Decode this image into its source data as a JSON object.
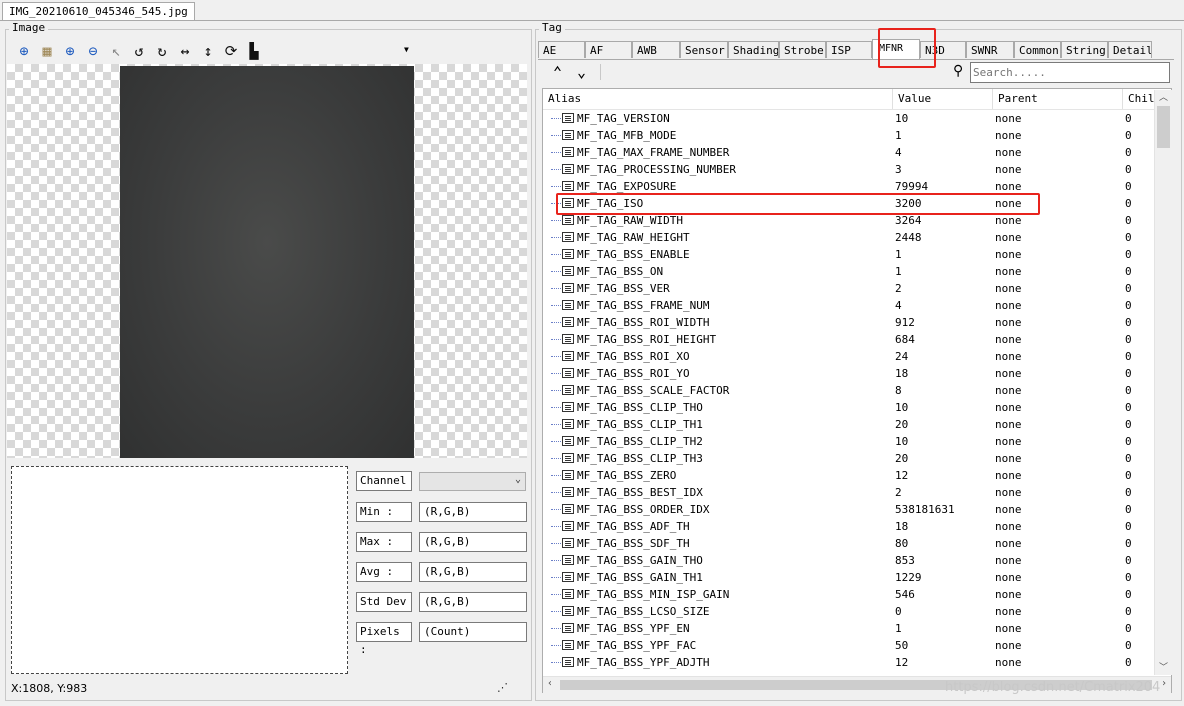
{
  "file_tab": "IMG_20210610_045346_545.jpg",
  "image_panel": {
    "title": "Image",
    "toolbar_icons": [
      "fit-icon",
      "grid-icon",
      "zoom-in-icon",
      "zoom-out-icon",
      "pointer-icon",
      "rotate-left-icon",
      "rotate-right-icon",
      "flip-horizontal-icon",
      "flip-vertical-icon",
      "refresh-icon",
      "histogram-icon",
      "dropdown-icon"
    ],
    "stats": [
      {
        "label": "Min :",
        "value": "(R,G,B)"
      },
      {
        "label": "Max :",
        "value": "(R,G,B)"
      },
      {
        "label": "Avg :",
        "value": "(R,G,B)"
      },
      {
        "label": "Std Dev",
        "value": "(R,G,B)"
      },
      {
        "label": "Pixels :",
        "value": "(Count)"
      }
    ],
    "channel_label": "Channel",
    "channel_value": "",
    "coords": "X:1808, Y:983"
  },
  "tag_panel": {
    "title": "Tag",
    "tabs": [
      "AE",
      "AF",
      "AWB",
      "Sensor",
      "Shading",
      "Strobe",
      "ISP",
      "MFNR",
      "N3D",
      "SWNR",
      "Common",
      "String",
      "Detail"
    ],
    "active_tab": "MFNR",
    "search_placeholder": "Search.....",
    "columns": [
      "Alias",
      "Value",
      "Parent",
      "Chil"
    ],
    "rows": [
      {
        "alias": "MF_TAG_VERSION",
        "value": "10",
        "parent": "none",
        "child": "0"
      },
      {
        "alias": "MF_TAG_MFB_MODE",
        "value": "1",
        "parent": "none",
        "child": "0"
      },
      {
        "alias": "MF_TAG_MAX_FRAME_NUMBER",
        "value": "4",
        "parent": "none",
        "child": "0"
      },
      {
        "alias": "MF_TAG_PROCESSING_NUMBER",
        "value": "3",
        "parent": "none",
        "child": "0"
      },
      {
        "alias": "MF_TAG_EXPOSURE",
        "value": "79994",
        "parent": "none",
        "child": "0"
      },
      {
        "alias": "MF_TAG_ISO",
        "value": "3200",
        "parent": "none",
        "child": "0"
      },
      {
        "alias": "MF_TAG_RAW_WIDTH",
        "value": "3264",
        "parent": "none",
        "child": "0"
      },
      {
        "alias": "MF_TAG_RAW_HEIGHT",
        "value": "2448",
        "parent": "none",
        "child": "0"
      },
      {
        "alias": "MF_TAG_BSS_ENABLE",
        "value": "1",
        "parent": "none",
        "child": "0"
      },
      {
        "alias": "MF_TAG_BSS_ON",
        "value": "1",
        "parent": "none",
        "child": "0"
      },
      {
        "alias": "MF_TAG_BSS_VER",
        "value": "2",
        "parent": "none",
        "child": "0"
      },
      {
        "alias": "MF_TAG_BSS_FRAME_NUM",
        "value": "4",
        "parent": "none",
        "child": "0"
      },
      {
        "alias": "MF_TAG_BSS_ROI_WIDTH",
        "value": "912",
        "parent": "none",
        "child": "0"
      },
      {
        "alias": "MF_TAG_BSS_ROI_HEIGHT",
        "value": "684",
        "parent": "none",
        "child": "0"
      },
      {
        "alias": "MF_TAG_BSS_ROI_XO",
        "value": "24",
        "parent": "none",
        "child": "0"
      },
      {
        "alias": "MF_TAG_BSS_ROI_YO",
        "value": "18",
        "parent": "none",
        "child": "0"
      },
      {
        "alias": "MF_TAG_BSS_SCALE_FACTOR",
        "value": "8",
        "parent": "none",
        "child": "0"
      },
      {
        "alias": "MF_TAG_BSS_CLIP_THO",
        "value": "10",
        "parent": "none",
        "child": "0"
      },
      {
        "alias": "MF_TAG_BSS_CLIP_TH1",
        "value": "20",
        "parent": "none",
        "child": "0"
      },
      {
        "alias": "MF_TAG_BSS_CLIP_TH2",
        "value": "10",
        "parent": "none",
        "child": "0"
      },
      {
        "alias": "MF_TAG_BSS_CLIP_TH3",
        "value": "20",
        "parent": "none",
        "child": "0"
      },
      {
        "alias": "MF_TAG_BSS_ZERO",
        "value": "12",
        "parent": "none",
        "child": "0"
      },
      {
        "alias": "MF_TAG_BSS_BEST_IDX",
        "value": "2",
        "parent": "none",
        "child": "0"
      },
      {
        "alias": "MF_TAG_BSS_ORDER_IDX",
        "value": "538181631",
        "parent": "none",
        "child": "0"
      },
      {
        "alias": "MF_TAG_BSS_ADF_TH",
        "value": "18",
        "parent": "none",
        "child": "0"
      },
      {
        "alias": "MF_TAG_BSS_SDF_TH",
        "value": "80",
        "parent": "none",
        "child": "0"
      },
      {
        "alias": "MF_TAG_BSS_GAIN_THO",
        "value": "853",
        "parent": "none",
        "child": "0"
      },
      {
        "alias": "MF_TAG_BSS_GAIN_TH1",
        "value": "1229",
        "parent": "none",
        "child": "0"
      },
      {
        "alias": "MF_TAG_BSS_MIN_ISP_GAIN",
        "value": "546",
        "parent": "none",
        "child": "0"
      },
      {
        "alias": "MF_TAG_BSS_LCSO_SIZE",
        "value": "0",
        "parent": "none",
        "child": "0"
      },
      {
        "alias": "MF_TAG_BSS_YPF_EN",
        "value": "1",
        "parent": "none",
        "child": "0"
      },
      {
        "alias": "MF_TAG_BSS_YPF_FAC",
        "value": "50",
        "parent": "none",
        "child": "0"
      },
      {
        "alias": "MF_TAG_BSS_YPF_ADJTH",
        "value": "12",
        "parent": "none",
        "child": "0"
      }
    ]
  },
  "watermark": "https://blog.csdn.net/Cmatrix204",
  "colors": {
    "highlight": "#e8231c",
    "accent_icon": "#1e5bbf"
  }
}
